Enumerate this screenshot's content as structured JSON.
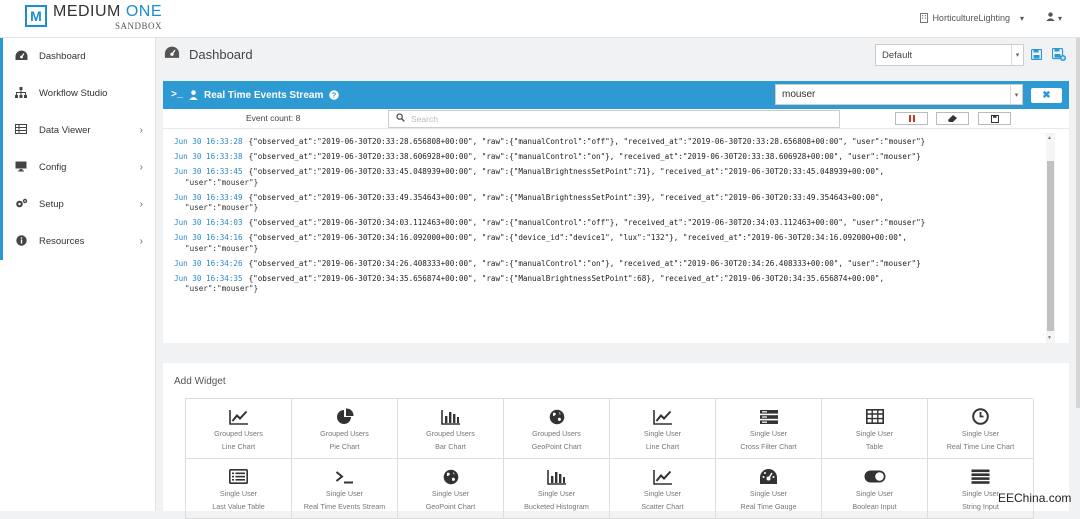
{
  "brand": {
    "title_part1": "MEDIUM",
    "title_part2": "ONE",
    "subtitle": "SANDBOX",
    "mark": "M"
  },
  "header": {
    "project": "HorticultureLighting",
    "project_caret": "▾",
    "user_caret": "▾"
  },
  "sidebar": {
    "items": [
      {
        "label": "Dashboard",
        "icon": "dashboard-icon",
        "chevron": ""
      },
      {
        "label": "Workflow Studio",
        "icon": "sitemap-icon",
        "chevron": ""
      },
      {
        "label": "Data Viewer",
        "icon": "table-icon",
        "chevron": "›"
      },
      {
        "label": "Config",
        "icon": "monitor-icon",
        "chevron": "›"
      },
      {
        "label": "Setup",
        "icon": "gears-icon",
        "chevron": "›"
      },
      {
        "label": "Resources",
        "icon": "info-icon",
        "chevron": "›"
      }
    ]
  },
  "page": {
    "title": "Dashboard",
    "dashboard_select": "Default"
  },
  "stream": {
    "title": "Real Time Events Stream",
    "filter_value": "mouser",
    "close_label": "✖",
    "event_count": "Event count: 8",
    "search_placeholder": "Search",
    "events": [
      {
        "ts": "Jun 30 16:33:28",
        "body": "{\"observed_at\":\"2019-06-30T20:33:28.656808+00:00\", \"raw\":{\"manualControl\":\"off\"}, \"received_at\":\"2019-06-30T20:33:28.656808+00:00\", \"user\":\"mouser\"}",
        "cont": ""
      },
      {
        "ts": "Jun 30 16:33:38",
        "body": "{\"observed_at\":\"2019-06-30T20:33:38.606928+00:00\", \"raw\":{\"manualControl\":\"on\"}, \"received_at\":\"2019-06-30T20:33:38.606928+00:00\", \"user\":\"mouser\"}",
        "cont": ""
      },
      {
        "ts": "Jun 30 16:33:45",
        "body": "{\"observed_at\":\"2019-06-30T20:33:45.048939+00:00\", \"raw\":{\"ManualBrightnessSetPoint\":71}, \"received_at\":\"2019-06-30T20:33:45.048939+00:00\",",
        "cont": "\"user\":\"mouser\"}"
      },
      {
        "ts": "Jun 30 16:33:49",
        "body": "{\"observed_at\":\"2019-06-30T20:33:49.354643+00:00\", \"raw\":{\"ManualBrightnessSetPoint\":39}, \"received_at\":\"2019-06-30T20:33:49.354643+00:00\",",
        "cont": "\"user\":\"mouser\"}"
      },
      {
        "ts": "Jun 30 16:34:03",
        "body": "{\"observed_at\":\"2019-06-30T20:34:03.112463+00:00\", \"raw\":{\"manualControl\":\"off\"}, \"received_at\":\"2019-06-30T20:34:03.112463+00:00\", \"user\":\"mouser\"}",
        "cont": ""
      },
      {
        "ts": "Jun 30 16:34:16",
        "body": "{\"observed_at\":\"2019-06-30T20:34:16.092000+00:00\", \"raw\":{\"device_id\":\"device1\", \"lux\":\"132\"}, \"received_at\":\"2019-06-30T20:34:16.092000+00:00\",",
        "cont": "\"user\":\"mouser\"}"
      },
      {
        "ts": "Jun 30 16:34:26",
        "body": "{\"observed_at\":\"2019-06-30T20:34:26.408333+00:00\", \"raw\":{\"manualControl\":\"on\"}, \"received_at\":\"2019-06-30T20:34:26.408333+00:00\", \"user\":\"mouser\"}",
        "cont": ""
      },
      {
        "ts": "Jun 30 16:34:35",
        "body": "{\"observed_at\":\"2019-06-30T20:34:35.656874+00:00\", \"raw\":{\"ManualBrightnessSetPoint\":68}, \"received_at\":\"2019-06-30T20:34:35.656874+00:00\",",
        "cont": "\"user\":\"mouser\"}"
      }
    ]
  },
  "widgets": {
    "title": "Add Widget",
    "items": [
      {
        "l1": "Grouped Users",
        "l2": "Line Chart",
        "icon": "line-chart-icon"
      },
      {
        "l1": "Grouped Users",
        "l2": "Pie Chart",
        "icon": "pie-chart-icon"
      },
      {
        "l1": "Grouped Users",
        "l2": "Bar Chart",
        "icon": "bar-chart-icon"
      },
      {
        "l1": "Grouped Users",
        "l2": "GeoPoint Chart",
        "icon": "globe-icon"
      },
      {
        "l1": "Single User",
        "l2": "Line Chart",
        "icon": "line-chart-icon"
      },
      {
        "l1": "Single User",
        "l2": "Cross Filter Chart",
        "icon": "server-icon"
      },
      {
        "l1": "Single User",
        "l2": "Table",
        "icon": "table-icon"
      },
      {
        "l1": "Single User",
        "l2": "Real Time Line Chart",
        "icon": "clock-icon"
      },
      {
        "l1": "Single User",
        "l2": "Last Value Table",
        "icon": "list-alt-icon"
      },
      {
        "l1": "Single User",
        "l2": "Real Time Events Stream",
        "icon": "terminal-icon"
      },
      {
        "l1": "Single User",
        "l2": "GeoPoint Chart",
        "icon": "globe-icon"
      },
      {
        "l1": "Single User",
        "l2": "Bucketed Histogram",
        "icon": "bar-chart-icon"
      },
      {
        "l1": "Single User",
        "l2": "Scatter Chart",
        "icon": "line-chart-icon"
      },
      {
        "l1": "Single User",
        "l2": "Real Time Gauge",
        "icon": "gauge-icon"
      },
      {
        "l1": "Single User",
        "l2": "Boolean Input",
        "icon": "toggle-icon"
      },
      {
        "l1": "Single User",
        "l2": "String Input",
        "icon": "bars-icon"
      }
    ]
  },
  "watermark": "EEChina.com"
}
